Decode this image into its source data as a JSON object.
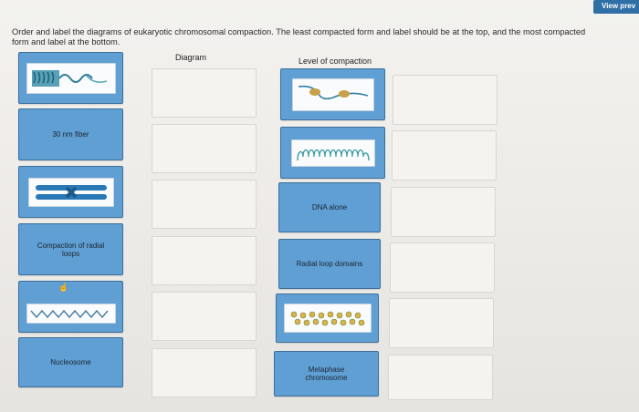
{
  "toolbar": {
    "view_preview_label": "View prev"
  },
  "instructions": "Order and label the diagrams of eukaryotic chromosomal compaction. The least compacted form and label should be at the top, and the most compacted form and label at the bottom.",
  "headers": {
    "diagram": "Diagram",
    "level": "Level of compaction"
  },
  "left_tiles": [
    {
      "type": "image",
      "icon": "chromosome-fiber-image"
    },
    {
      "type": "label",
      "text": "30 nm fiber"
    },
    {
      "type": "image",
      "icon": "metaphase-chromosome-image"
    },
    {
      "type": "label",
      "text": "Compaction of radial loops"
    },
    {
      "type": "image",
      "icon": "zigzag-nucleosome-image"
    },
    {
      "type": "label",
      "text": "Nucleosome"
    }
  ],
  "right_tiles": [
    {
      "type": "image",
      "icon": "dna-alone-image"
    },
    {
      "type": "image",
      "icon": "radial-loop-image"
    },
    {
      "type": "label",
      "text": "DNA alone"
    },
    {
      "type": "label",
      "text": "Radial loop domains"
    },
    {
      "type": "image",
      "icon": "thirty-nm-fiber-image"
    },
    {
      "type": "label",
      "text": "Metaphase chromosome"
    }
  ],
  "colors": {
    "tile": "#5f9fd3",
    "tile_border": "#3d6f9a",
    "accent": "#2f6fa6"
  }
}
